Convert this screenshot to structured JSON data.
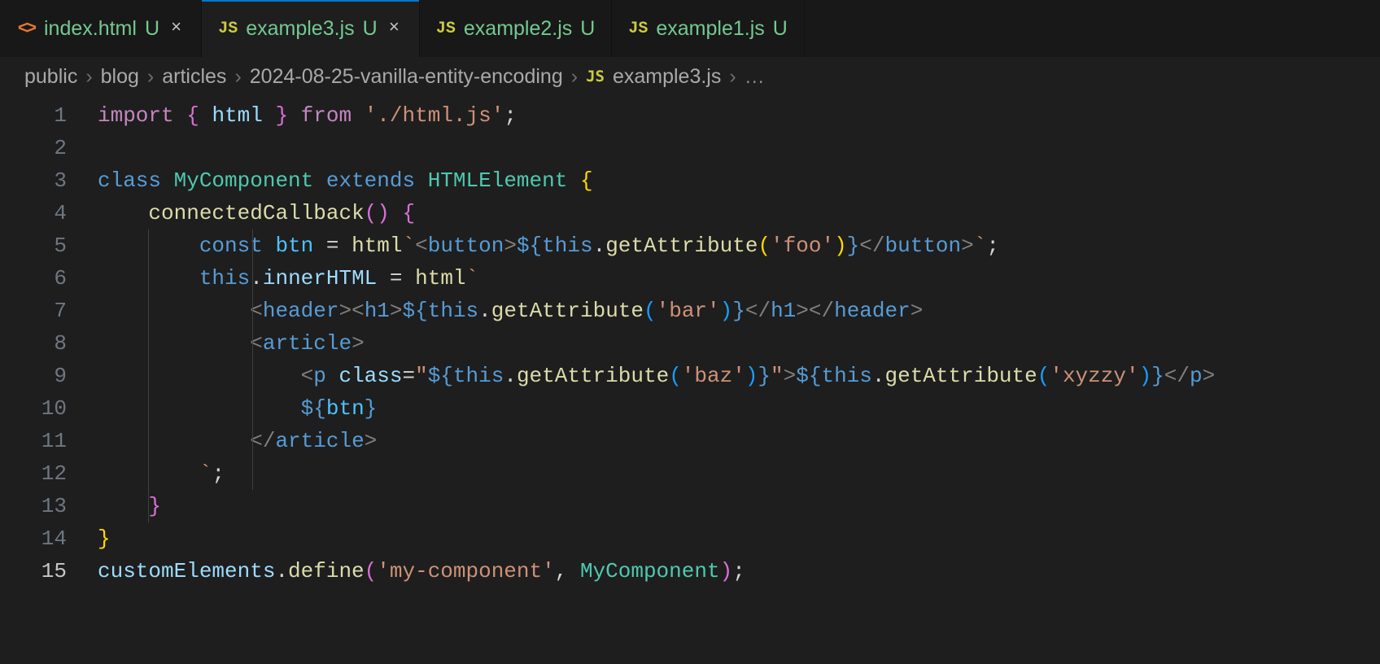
{
  "tabs": [
    {
      "icon": "html",
      "iconText": "<>",
      "label": "index.html",
      "badge": "U",
      "closeVisible": true,
      "active": false
    },
    {
      "icon": "js",
      "iconText": "JS",
      "label": "example3.js",
      "badge": "U",
      "closeVisible": true,
      "active": true
    },
    {
      "icon": "js",
      "iconText": "JS",
      "label": "example2.js",
      "badge": "U",
      "closeVisible": false,
      "active": false
    },
    {
      "icon": "js",
      "iconText": "JS",
      "label": "example1.js",
      "badge": "U",
      "closeVisible": false,
      "active": false
    }
  ],
  "breadcrumb": {
    "segments": [
      "public",
      "blog",
      "articles",
      "2024-08-25-vanilla-entity-encoding"
    ],
    "fileIcon": "JS",
    "file": "example3.js",
    "trailing": "…",
    "sep": "›"
  },
  "closeGlyph": "×",
  "editor": {
    "lines": [
      {
        "n": 1,
        "tokens": [
          [
            "tk-imp",
            "import "
          ],
          [
            "tk-bp",
            "{ "
          ],
          [
            "tk-var",
            "html"
          ],
          [
            "tk-bp",
            " }"
          ],
          [
            "tk-imp",
            " from "
          ],
          [
            "tk-str",
            "'./html.js'"
          ],
          [
            "tk-w",
            ";"
          ]
        ]
      },
      {
        "n": 2,
        "tokens": []
      },
      {
        "n": 3,
        "tokens": [
          [
            "tk-kw",
            "class "
          ],
          [
            "tk-cls",
            "MyComponent"
          ],
          [
            "tk-kw",
            " extends "
          ],
          [
            "tk-cls",
            "HTMLElement"
          ],
          [
            "tk-w",
            " "
          ],
          [
            "tk-by",
            "{"
          ]
        ]
      },
      {
        "n": 4,
        "indent": 1,
        "guides": [],
        "tokens": [
          [
            "tk-w",
            "    "
          ],
          [
            "tk-fn",
            "connectedCallback"
          ],
          [
            "tk-bp",
            "()"
          ],
          [
            "tk-w",
            " "
          ],
          [
            "tk-bp",
            "{"
          ]
        ]
      },
      {
        "n": 5,
        "indent": 2,
        "guides": [
          1,
          2
        ],
        "tokens": [
          [
            "tk-w",
            "        "
          ],
          [
            "tk-kw",
            "const "
          ],
          [
            "tk-const",
            "btn"
          ],
          [
            "tk-w",
            " = "
          ],
          [
            "tk-fn",
            "html"
          ],
          [
            "tk-str",
            "`"
          ],
          [
            "tk-tag",
            "<"
          ],
          [
            "tk-kw",
            "button"
          ],
          [
            "tk-tag",
            ">"
          ],
          [
            "tk-kw",
            "${"
          ],
          [
            "tk-kw",
            "this"
          ],
          [
            "tk-w",
            "."
          ],
          [
            "tk-fn",
            "getAttribute"
          ],
          [
            "tk-by",
            "("
          ],
          [
            "tk-str",
            "'foo'"
          ],
          [
            "tk-by",
            ")"
          ],
          [
            "tk-kw",
            "}"
          ],
          [
            "tk-tag",
            "</"
          ],
          [
            "tk-kw",
            "button"
          ],
          [
            "tk-tag",
            ">"
          ],
          [
            "tk-str",
            "`"
          ],
          [
            "tk-w",
            ";"
          ]
        ]
      },
      {
        "n": 6,
        "indent": 2,
        "guides": [
          1,
          2
        ],
        "tokens": [
          [
            "tk-w",
            "        "
          ],
          [
            "tk-kw",
            "this"
          ],
          [
            "tk-w",
            "."
          ],
          [
            "tk-var",
            "innerHTML"
          ],
          [
            "tk-w",
            " = "
          ],
          [
            "tk-fn",
            "html"
          ],
          [
            "tk-str",
            "`"
          ]
        ]
      },
      {
        "n": 7,
        "indent": 3,
        "guides": [
          1,
          2
        ],
        "tokens": [
          [
            "tk-str",
            "            "
          ],
          [
            "tk-tag",
            "<"
          ],
          [
            "tk-kw",
            "header"
          ],
          [
            "tk-tag",
            "><"
          ],
          [
            "tk-kw",
            "h1"
          ],
          [
            "tk-tag",
            ">"
          ],
          [
            "tk-kw",
            "${"
          ],
          [
            "tk-kw",
            "this"
          ],
          [
            "tk-w",
            "."
          ],
          [
            "tk-fn",
            "getAttribute"
          ],
          [
            "tk-bb",
            "("
          ],
          [
            "tk-str",
            "'bar'"
          ],
          [
            "tk-bb",
            ")"
          ],
          [
            "tk-kw",
            "}"
          ],
          [
            "tk-tag",
            "</"
          ],
          [
            "tk-kw",
            "h1"
          ],
          [
            "tk-tag",
            "></"
          ],
          [
            "tk-kw",
            "header"
          ],
          [
            "tk-tag",
            ">"
          ]
        ]
      },
      {
        "n": 8,
        "indent": 3,
        "guides": [
          1,
          2
        ],
        "tokens": [
          [
            "tk-str",
            "            "
          ],
          [
            "tk-tag",
            "<"
          ],
          [
            "tk-kw",
            "article"
          ],
          [
            "tk-tag",
            ">"
          ]
        ]
      },
      {
        "n": 9,
        "indent": 4,
        "guides": [
          1,
          2
        ],
        "tokens": [
          [
            "tk-str",
            "                "
          ],
          [
            "tk-tag",
            "<"
          ],
          [
            "tk-kw",
            "p "
          ],
          [
            "tk-var",
            "class"
          ],
          [
            "tk-w",
            "="
          ],
          [
            "tk-str",
            "\""
          ],
          [
            "tk-kw",
            "${"
          ],
          [
            "tk-kw",
            "this"
          ],
          [
            "tk-w",
            "."
          ],
          [
            "tk-fn",
            "getAttribute"
          ],
          [
            "tk-bb",
            "("
          ],
          [
            "tk-str",
            "'baz'"
          ],
          [
            "tk-bb",
            ")"
          ],
          [
            "tk-kw",
            "}"
          ],
          [
            "tk-str",
            "\""
          ],
          [
            "tk-tag",
            ">"
          ],
          [
            "tk-kw",
            "${"
          ],
          [
            "tk-kw",
            "this"
          ],
          [
            "tk-w",
            "."
          ],
          [
            "tk-fn",
            "getAttribute"
          ],
          [
            "tk-bb",
            "("
          ],
          [
            "tk-str",
            "'xyzzy'"
          ],
          [
            "tk-bb",
            ")"
          ],
          [
            "tk-kw",
            "}"
          ],
          [
            "tk-tag",
            "</"
          ],
          [
            "tk-kw",
            "p"
          ],
          [
            "tk-tag",
            ">"
          ]
        ]
      },
      {
        "n": 10,
        "indent": 4,
        "guides": [
          1,
          2
        ],
        "tokens": [
          [
            "tk-str",
            "                "
          ],
          [
            "tk-kw",
            "${"
          ],
          [
            "tk-const",
            "btn"
          ],
          [
            "tk-kw",
            "}"
          ]
        ]
      },
      {
        "n": 11,
        "indent": 3,
        "guides": [
          1,
          2
        ],
        "tokens": [
          [
            "tk-str",
            "            "
          ],
          [
            "tk-tag",
            "</"
          ],
          [
            "tk-kw",
            "article"
          ],
          [
            "tk-tag",
            ">"
          ]
        ]
      },
      {
        "n": 12,
        "indent": 2,
        "guides": [
          1,
          2
        ],
        "tokens": [
          [
            "tk-str",
            "        `"
          ],
          [
            "tk-w",
            ";"
          ]
        ]
      },
      {
        "n": 13,
        "indent": 1,
        "guides": [
          1
        ],
        "tokens": [
          [
            "tk-w",
            "    "
          ],
          [
            "tk-bp",
            "}"
          ]
        ]
      },
      {
        "n": 14,
        "tokens": [
          [
            "tk-by",
            "}"
          ]
        ]
      },
      {
        "n": 15,
        "active": true,
        "tokens": [
          [
            "tk-var",
            "customElements"
          ],
          [
            "tk-w",
            "."
          ],
          [
            "tk-fn",
            "define"
          ],
          [
            "tk-bp",
            "("
          ],
          [
            "tk-str",
            "'my-component'"
          ],
          [
            "tk-w",
            ", "
          ],
          [
            "tk-cls",
            "MyComponent"
          ],
          [
            "tk-bp",
            ")"
          ],
          [
            "tk-w",
            ";"
          ]
        ]
      }
    ]
  }
}
